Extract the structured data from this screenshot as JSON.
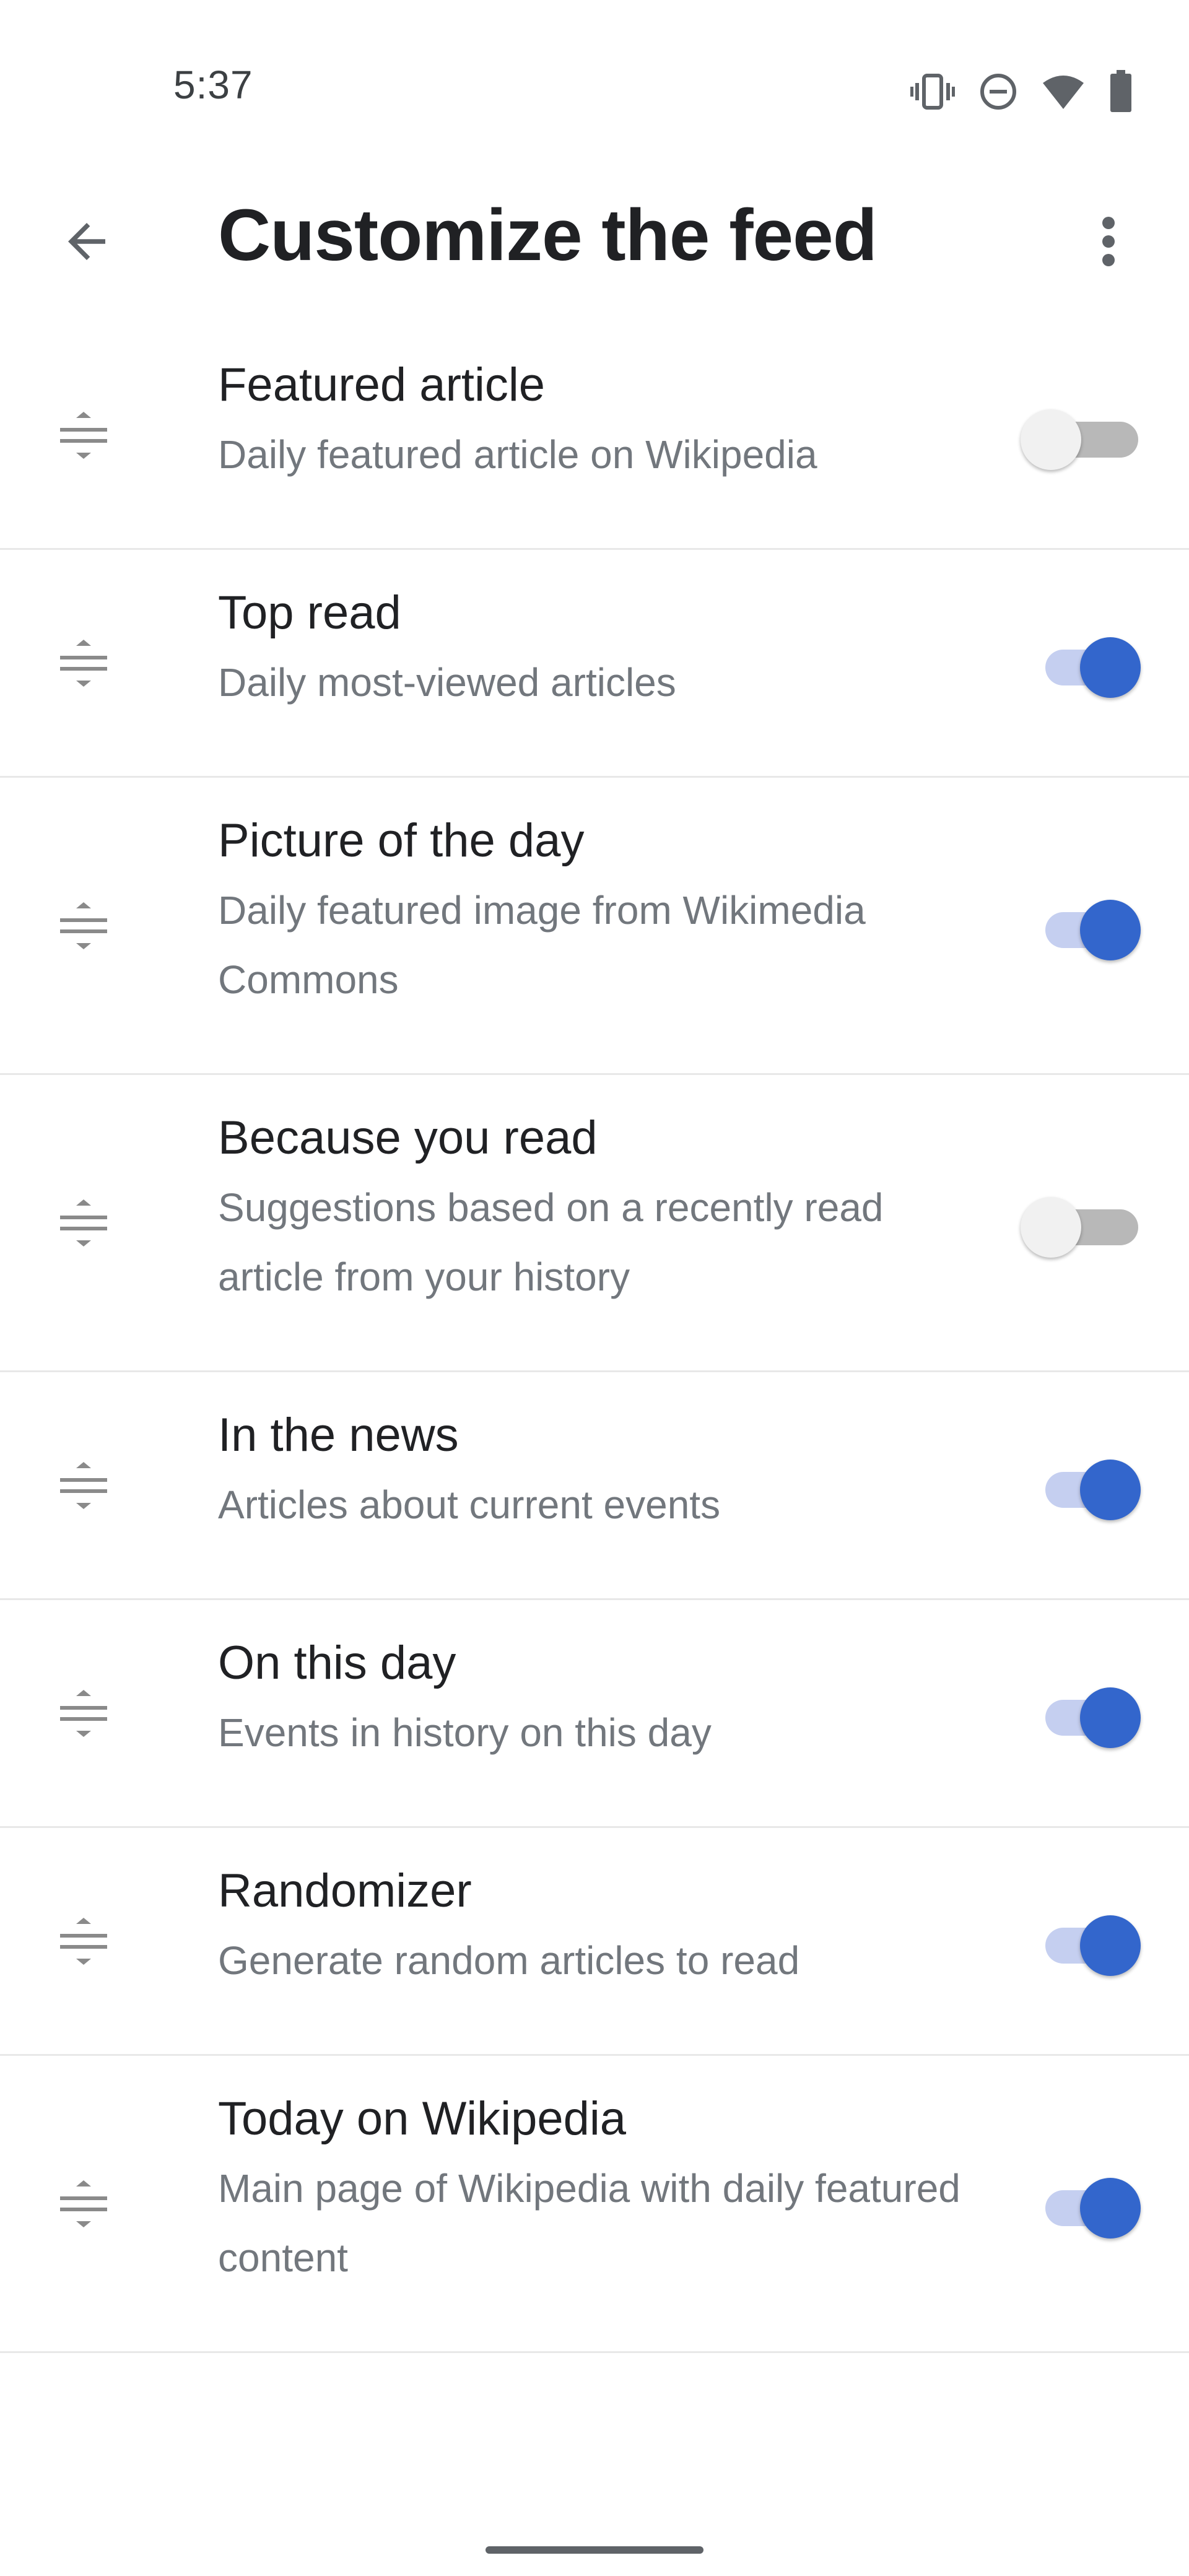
{
  "status_bar": {
    "time": "5:37",
    "icons": [
      "vibrate-icon",
      "do-not-disturb-icon",
      "wifi-icon",
      "battery-icon"
    ]
  },
  "app_bar": {
    "title": "Customize the feed",
    "back_icon": "arrow-back-icon",
    "overflow_icon": "more-vert-icon"
  },
  "colors": {
    "accent": "#3366cc",
    "accent_track": "#c5cff0",
    "title_text": "#202124",
    "secondary_text": "#72777d",
    "divider": "#e8e8e8",
    "off_thumb": "#f1f1f1",
    "off_track": "#b8b8b8"
  },
  "feed_items": [
    {
      "title": "Featured article",
      "description": "Daily featured article on Wikipedia",
      "enabled": false
    },
    {
      "title": "Top read",
      "description": "Daily most-viewed articles",
      "enabled": true
    },
    {
      "title": "Picture of the day",
      "description": "Daily featured image from Wikimedia Commons",
      "enabled": true
    },
    {
      "title": "Because you read",
      "description": "Suggestions based on a recently read article from your history",
      "enabled": false
    },
    {
      "title": "In the news",
      "description": "Articles about current events",
      "enabled": true
    },
    {
      "title": "On this day",
      "description": "Events in history on this day",
      "enabled": true
    },
    {
      "title": "Randomizer",
      "description": "Generate random articles to read",
      "enabled": true
    },
    {
      "title": "Today on Wikipedia",
      "description": "Main page of Wikipedia with daily featured content",
      "enabled": true
    }
  ]
}
